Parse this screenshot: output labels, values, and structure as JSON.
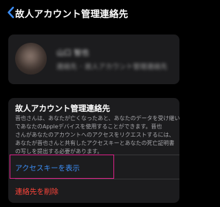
{
  "nav": {
    "title": "故人アカウント管理連絡先"
  },
  "profile": {
    "name": "山口 智也",
    "sub": "連絡先 ･ 故人アカウント管理連絡先"
  },
  "info": {
    "title": "故人アカウント管理連絡先",
    "body_lines": [
      "晋也さんは、あなたが亡くなったあと、あなたのデータを受け継い",
      "であなたのAppleデバイスを使用することができます。晋也",
      "さんがあなたのアカウントへのアクセスをリクエストするには、",
      "あなたが晋也さんと共有したアクセスキーとあなたの死亡証明書",
      "の写しを提出する必要があります。"
    ]
  },
  "actions": {
    "show_key": "アクセスキーを表示",
    "delete_contact": "連絡先を削除"
  },
  "colors": {
    "link_blue": "#3d8ef5",
    "destructive_red": "#ff453a",
    "highlight": "#e0218a"
  }
}
